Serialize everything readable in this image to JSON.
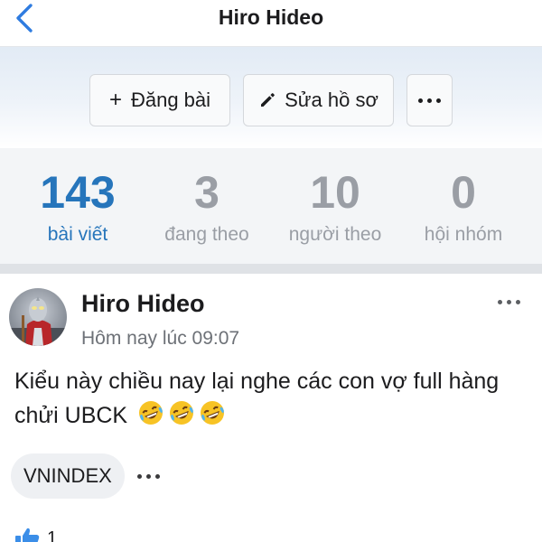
{
  "navbar": {
    "title": "Hiro Hideo",
    "back_icon": "chevron-left-icon"
  },
  "actions": {
    "post_label": "Đăng bài",
    "post_icon": "plus-icon",
    "edit_label": "Sửa hồ sơ",
    "edit_icon": "pencil-icon",
    "more_icon": "more-horizontal-icon"
  },
  "stats": [
    {
      "value": "143",
      "label": "bài viết",
      "active": true
    },
    {
      "value": "3",
      "label": "đang theo",
      "active": false
    },
    {
      "value": "10",
      "label": "người theo",
      "active": false
    },
    {
      "value": "0",
      "label": "hội nhóm",
      "active": false
    }
  ],
  "post": {
    "author": "Hiro Hideo",
    "time": "Hôm nay lúc 09:07",
    "text": "Kiểu này chiều nay lại nghe các con vợ full hàng chửi UBCK",
    "emojis": [
      "rolling-on-floor-laughing-emoji",
      "rolling-on-floor-laughing-emoji",
      "rolling-on-floor-laughing-emoji"
    ],
    "tag": "VNINDEX",
    "like_count": "1"
  },
  "colors": {
    "accent": "#2675bb",
    "muted": "#9a9ea5",
    "stats_bg": "#f3f5f7",
    "like_blue": "#3b8ee8"
  }
}
